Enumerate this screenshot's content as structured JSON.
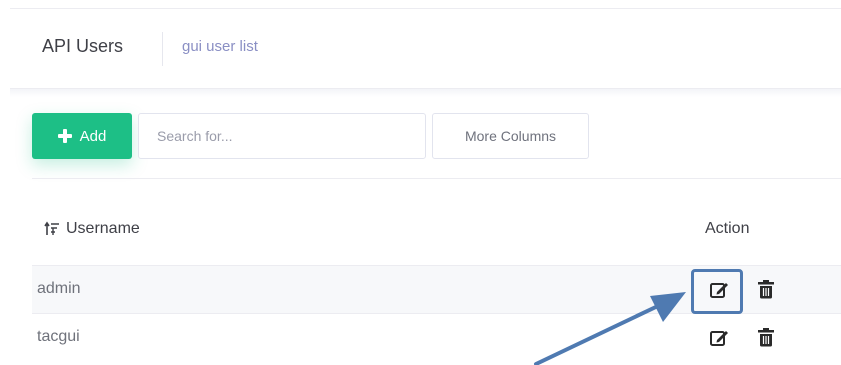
{
  "header": {
    "title": "API Users",
    "subtitle": "gui user list"
  },
  "toolbar": {
    "add_label": "Add",
    "search_placeholder": "Search for...",
    "more_columns_label": "More Columns"
  },
  "table": {
    "columns": [
      "Username",
      "Action"
    ],
    "rows": [
      {
        "username": "admin"
      },
      {
        "username": "tacgui"
      }
    ]
  },
  "colors": {
    "add_button": "#1dbf86",
    "annotation": "#4f7ab1",
    "subtitle": "#8a8fc4"
  },
  "icons": {
    "add": "plus-icon",
    "sort": "sort-icon",
    "edit": "edit-icon",
    "delete": "trash-icon"
  }
}
